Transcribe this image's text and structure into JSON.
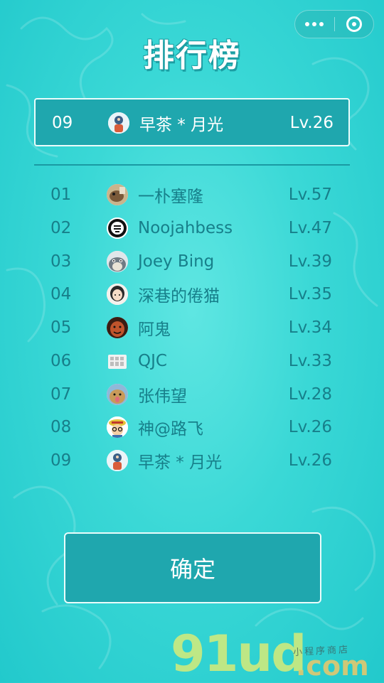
{
  "window": {
    "title": "排行榜"
  },
  "capsule": {
    "menu_icon": "more-dots-icon",
    "close_icon": "target-close-icon"
  },
  "my_rank": {
    "rank": "09",
    "name": "早茶 * 月光",
    "level": "Lv.26",
    "avatar_icon": "avatar-tea-moonlight"
  },
  "ranking": [
    {
      "rank": "01",
      "name": "一朴塞隆",
      "level": "Lv.57",
      "avatar_icon": "avatar-dog"
    },
    {
      "rank": "02",
      "name": "Noojahbess",
      "level": "Lv.47",
      "avatar_icon": "avatar-badge"
    },
    {
      "rank": "03",
      "name": "Joey Bing",
      "level": "Lv.39",
      "avatar_icon": "avatar-totoro"
    },
    {
      "rank": "04",
      "name": "深巷的倦猫",
      "level": "Lv.35",
      "avatar_icon": "avatar-girl"
    },
    {
      "rank": "05",
      "name": "阿鬼",
      "level": "Lv.34",
      "avatar_icon": "avatar-face"
    },
    {
      "rank": "06",
      "name": "QJC",
      "level": "Lv.33",
      "avatar_icon": "avatar-keyboard"
    },
    {
      "rank": "07",
      "name": "张伟望",
      "level": "Lv.28",
      "avatar_icon": "avatar-puppy"
    },
    {
      "rank": "08",
      "name": "神@路飞",
      "level": "Lv.26",
      "avatar_icon": "avatar-luffy"
    },
    {
      "rank": "09",
      "name": "早茶 * 月光",
      "level": "Lv.26",
      "avatar_icon": "avatar-tea-moonlight"
    }
  ],
  "confirm_button": {
    "label": "确定"
  },
  "watermark": {
    "main": "91ud",
    "domain": ".com",
    "tagline": "小程序商店"
  },
  "colors": {
    "background": "#3ad8d6",
    "panel": "#1fa7ae",
    "panel_border": "#eafcfb",
    "list_text": "#177f8a",
    "white_text": "#ffffff"
  }
}
